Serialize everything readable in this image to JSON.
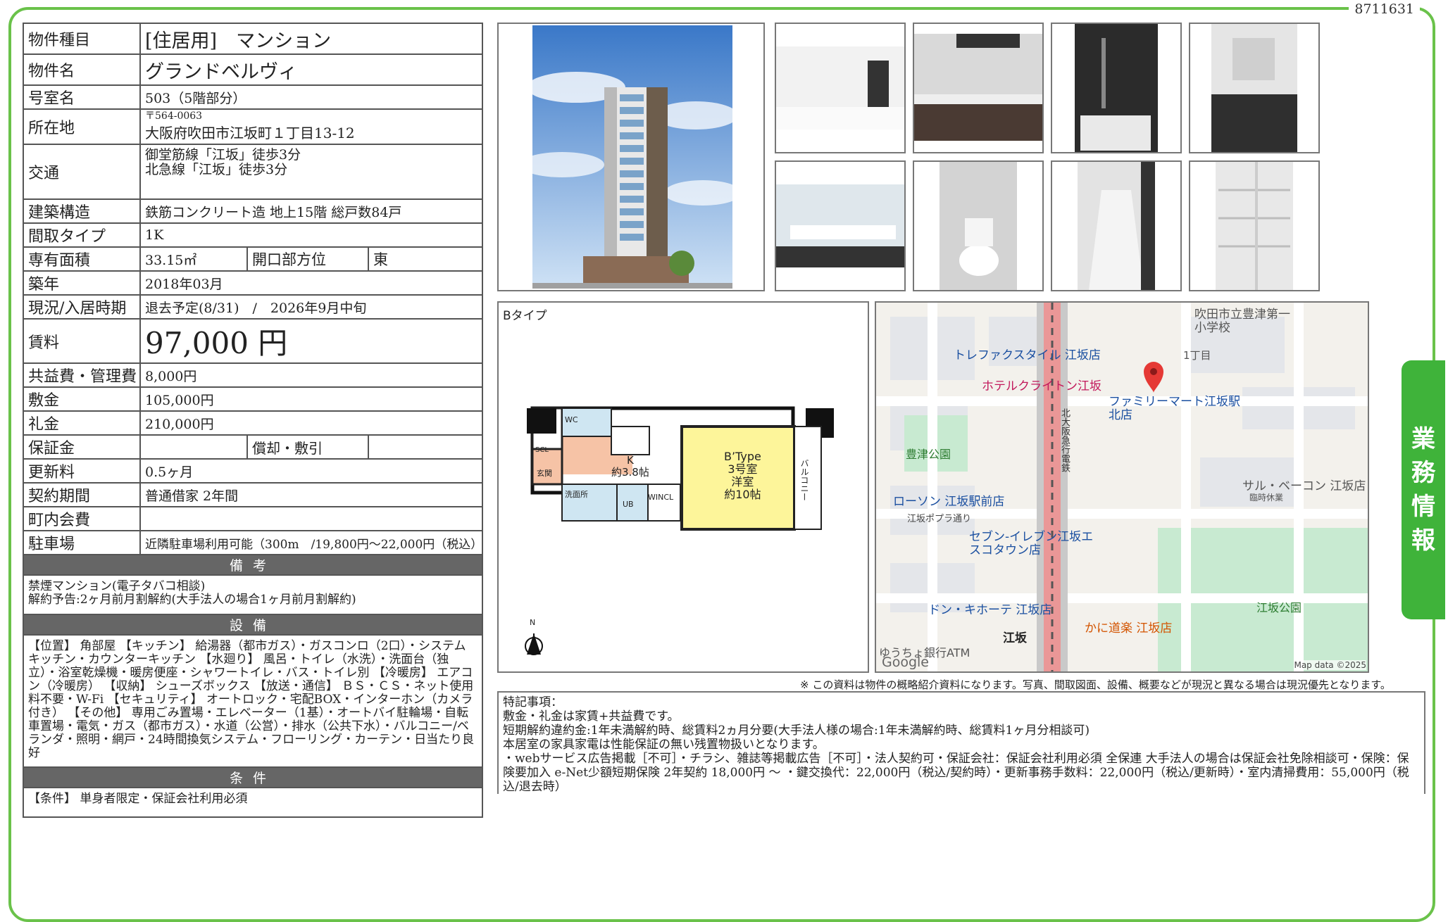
{
  "doc_number": "8711631",
  "side_tab": [
    "業",
    "務",
    "情",
    "報"
  ],
  "rows": {
    "type_label": "物件種目",
    "type_value": "[住居用]　マンション",
    "name_label": "物件名",
    "name_value": "グランドベルヴィ",
    "room_label": "号室名",
    "room_value": "503（5階部分）",
    "addr_label": "所在地",
    "addr_zip": "〒564-0063",
    "addr_value": "大阪府吹田市江坂町１丁目13-12",
    "access_label": "交通",
    "access_1": "御堂筋線「江坂」徒歩3分",
    "access_2": "北急線「江坂」徒歩3分",
    "struct_label": "建築構造",
    "struct_value": "鉄筋コンクリート造 地上15階 総戸数84戸",
    "layout_label": "間取タイプ",
    "layout_value": "1K",
    "area_label": "専有面積",
    "area_value": "33.15㎡",
    "dir_label": "開口部方位",
    "dir_value": "東",
    "built_label": "築年",
    "built_value": "2018年03月",
    "status_label": "現況/入居時期",
    "status_value": "退去予定(8/31)　/　2026年9月中旬",
    "rent_label": "賃料",
    "rent_value": "97,000 円",
    "fee_label": "共益費・管理費",
    "fee_value": "8,000円",
    "deposit_label": "敷金",
    "deposit_value": "105,000円",
    "key_label": "礼金",
    "key_value": "210,000円",
    "guarantee_label": "保証金",
    "guarantee_value": "",
    "shokyaku_label": "償却・敷引",
    "shokyaku_value": "",
    "renew_label": "更新料",
    "renew_value": "0.5ヶ月",
    "contract_label": "契約期間",
    "contract_value": "普通借家 2年間",
    "town_label": "町内会費",
    "town_value": "",
    "parking_label": "駐車場",
    "parking_value": "近隣駐車場利用可能（300m　/19,800円〜22,000円（税込）"
  },
  "biko": {
    "header": "備考",
    "lines": [
      "禁煙マンション(電子タバコ相談)",
      "解約予告:2ヶ月前月割解約(大手法人の場合1ヶ月前月割解約)"
    ]
  },
  "setsubi": {
    "header": "設備",
    "text": "【位置】 角部屋 【キッチン】 給湯器（都市ガス）・ガスコンロ（2口）・システムキッチン・カウンターキッチン 【水廻り】 風呂・トイレ（水洗）・洗面台（独立）・浴室乾燥機・暖房便座・シャワートイレ・バス・トイレ別 【冷暖房】 エアコン（冷暖房） 【収納】 シューズボックス 【放送・通信】 ＢＳ・ＣＳ・ネット使用料不要・W-Fi 【セキュリティ】 オートロック・宅配BOX・インターホン（カメラ付き） 【その他】 専用ごみ置場・エレベーター（1基）・オートバイ駐輪場・自転車置場・電気・ガス（都市ガス）・水道（公営）・排水（公共下水）・バルコニー/ベランダ・照明・網戸・24時間換気システム・フローリング・カーテン・日当たり良好"
  },
  "joken": {
    "header": "条件",
    "text": "【条件】 単身者限定・保証会社利用必須"
  },
  "floorplan": {
    "label": "Bタイプ",
    "room_type": "B’Type",
    "room_no": "3号室",
    "room_kind": "洋室",
    "room_size": "約10帖",
    "kitchen": "K",
    "kitchen_size": "約3.8帖",
    "balcony": "バルコニー",
    "scl": "SCL",
    "entrance": "玄関",
    "wc": "WC",
    "washroom": "洗面所",
    "ub": "UB",
    "wincl": "WINCL",
    "north": "N"
  },
  "map": {
    "labels": {
      "school": "吹田市立豊津第一小学校",
      "trefac": "トレファクスタイル 江坂店",
      "chome": "1丁目",
      "hotel": "ホテルクライトン江坂",
      "famima": "ファミリーマート江坂駅北店",
      "park1": "豊津公園",
      "highway": "北大阪急行電鉄",
      "lawson": "ローソン 江坂駅前店",
      "poplar": "江坂ポプラ通り",
      "sal": "サル・ベーコン 江坂店",
      "sal_note": "臨時休業",
      "seven": "セブン-イレブン江坂エスコタウン店",
      "donki": "ドン・キホーテ 江坂店",
      "park2": "江坂公園",
      "kani": "かに道楽 江坂店",
      "esaka": "江坂",
      "bank": "ゆうちょ銀行ATM",
      "google": "Google",
      "mapdata": "Map data ©2025"
    }
  },
  "disclaimer": "※ この資料は物件の概略紹介資料になります。写真、間取図面、設備、概要などが現況と異なる場合は現況優先となります。",
  "tokki": {
    "title": "特記事項：",
    "l1": "敷金・礼金は家賃+共益費です。",
    "l2": "短期解約違約金:1年未満解約時、総賃料2ヵ月分要(大手法人様の場合:1年未満解約時、総賃料1ヶ月分相談可)",
    "l3": "本居室の家具家電は性能保証の無い残置物扱いとなります。",
    "l4": "・webサービス広告掲載［不可］・チラシ、雑誌等掲載広告［不可］・法人契約可・保証会社：保証会社利用必須 全保連 大手法人の場合は保証会社免除相談可・保険：保険要加入 e-Net少額短期保険 2年契約 18,000円 〜 ・鍵交換代：22,000円（税込/契約時）・更新事務手数料：22,000円（税込/更新時）・室内清掃費用：55,000円（税込/退去時）"
  },
  "colors": {
    "frame_green": "#6ac24a",
    "tab_green": "#3fb33a",
    "section_gray": "#666666"
  }
}
